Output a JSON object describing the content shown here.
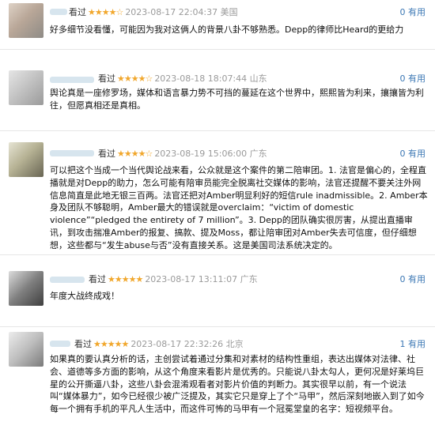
{
  "reviews": [
    {
      "watched_label": "看过",
      "stars": "★★★★☆",
      "rating": 4,
      "timestamp": "2023-08-17 22:04:37 美国",
      "useful": "0 有用",
      "content": "好多细节没看懂，可能因为我对这俩人的背景八卦不够熟悉。Depp的律师比Heard的更给力"
    },
    {
      "watched_label": "看过",
      "stars": "★★★★☆",
      "rating": 4,
      "timestamp": "2023-08-18 18:07:44 山东",
      "useful": "0 有用",
      "content": "舆论真是一座修罗场，媒体和语言暴力势不可挡的蔓延在这个世界中，熙熙皆为利来，攘攘皆为利往，但愿真相还是真相。"
    },
    {
      "watched_label": "看过",
      "stars": "★★★★☆",
      "rating": 4,
      "timestamp": "2023-08-19 15:06:00 广东",
      "useful": "0 有用",
      "content": "可以把这个当成一个当代舆论战来看，公众就是这个案件的第二陪审团。1. 法官是偏心的，全程直播就是对Depp的助力，怎么可能有陪审员能完全脱离社交媒体的影响，法官还提醒不要关注外网信息简直是此地无银三百两。法官还把对Amber明显利好的短信rule inadmissible。2. Amber本身及团队不够聪明，Amber最大的错误就是overclaim：“victim of domestic violence”“pledged the entirety of 7 million”。3. Depp的团队确实很厉害，从提出直播审讯，到攻击揣准Amber的报复、搞款、提及Moss，都让陪审团对Amber失去可信度，但仔细想想，这些都与“发生abuse与否”没有直接关系。这是美国司法系统决定的。"
    },
    {
      "watched_label": "看过",
      "stars": "★★★★★",
      "rating": 5,
      "timestamp": "2023-08-17 13:11:07 广东",
      "useful": "0 有用",
      "content": "年度大战终成戏！"
    },
    {
      "watched_label": "看过",
      "stars": "★★★★★",
      "rating": 5,
      "timestamp": "2023-08-17 22:32:26 北京",
      "useful": "1 有用",
      "content": "如果真的要认真分析的话，主创尝试着通过分集和对素材的结构性重组，表达出媒体对法律、社会、道德等多方面的影响，从这个角度来看影片是优秀的。只能说八卦太勾人，更何况是好莱坞巨星的公开撕逼八卦，这些八卦会混淆观看者对影片价值的判断力。其实很早以前，有一个说法叫“媒体暴力”，如今已经很少被广泛提及，其实它只是穿上了个“马甲”，然后深刻地嵌入到了如今每一个拥有手机的平凡人生活中，而这件可怖的马甲有一个冠冕堂皇的名字：短视频平台。"
    }
  ]
}
